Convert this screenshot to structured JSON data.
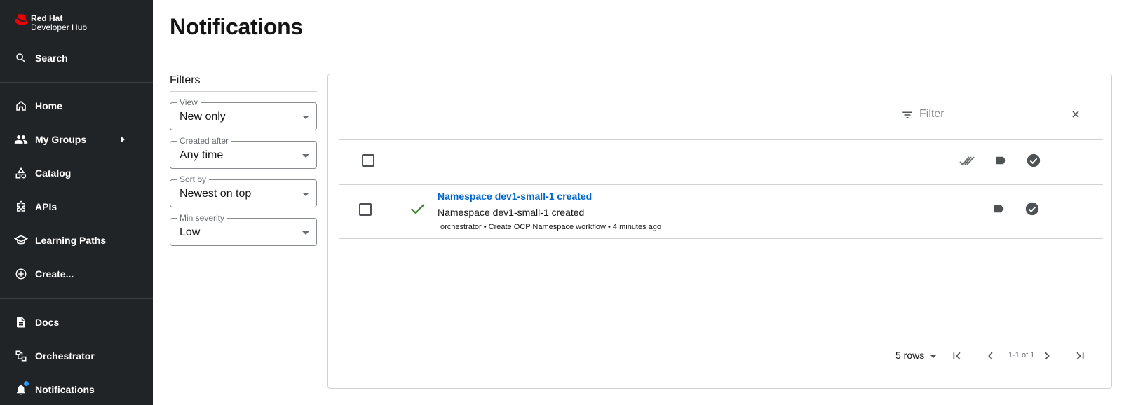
{
  "brand": {
    "line1": "Red Hat",
    "line2": "Developer Hub",
    "accent": "#ee0000"
  },
  "sidebar": {
    "search": "Search",
    "items": [
      {
        "label": "Home",
        "icon": "home-icon"
      },
      {
        "label": "My Groups",
        "icon": "group-icon"
      },
      {
        "label": "Catalog",
        "icon": "catalog-icon"
      },
      {
        "label": "APIs",
        "icon": "puzzle-icon"
      },
      {
        "label": "Learning Paths",
        "icon": "school-icon"
      },
      {
        "label": "Create...",
        "icon": "add-circle-icon"
      }
    ],
    "bottom_items": [
      {
        "label": "Docs",
        "icon": "doc-icon"
      },
      {
        "label": "Orchestrator",
        "icon": "orchestrator-icon"
      },
      {
        "label": "Notifications",
        "icon": "bell-icon"
      }
    ]
  },
  "page": {
    "title": "Notifications"
  },
  "filters": {
    "title": "Filters",
    "view": {
      "label": "View",
      "value": "New only"
    },
    "created_after": {
      "label": "Created after",
      "value": "Any time"
    },
    "sort_by": {
      "label": "Sort by",
      "value": "Newest on top"
    },
    "min_severity": {
      "label": "Min severity",
      "value": "Low"
    }
  },
  "table": {
    "filter_placeholder": "Filter",
    "rows": [
      {
        "title": "Namespace dev1-small-1 created",
        "description": "Namespace dev1-small-1 created",
        "meta": "orchestrator • Create OCP Namespace workflow • 4 minutes ago",
        "status_color": "#3e8635"
      }
    ]
  },
  "pagination": {
    "rows_label": "5 rows",
    "range": "1-1 of 1"
  }
}
